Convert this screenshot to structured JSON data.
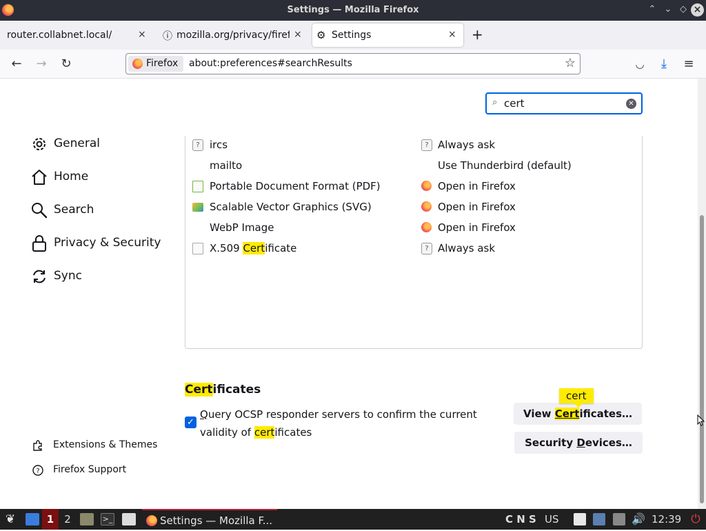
{
  "window": {
    "title": "Settings — Mozilla Firefox"
  },
  "tabs": [
    {
      "label": "router.collabnet.local/"
    },
    {
      "label": "mozilla.org/privacy/firefo"
    },
    {
      "label": "Settings"
    }
  ],
  "navbar": {
    "identity_label": "Firefox",
    "url": "about:preferences#searchResults"
  },
  "search": {
    "value": "cert"
  },
  "sidebar": {
    "categories": [
      {
        "label": "General",
        "icon": "gear-icon"
      },
      {
        "label": "Home",
        "icon": "home-icon"
      },
      {
        "label": "Search",
        "icon": "search-icon"
      },
      {
        "label": "Privacy & Security",
        "icon": "lock-icon"
      },
      {
        "label": "Sync",
        "icon": "sync-icon"
      }
    ],
    "footer": [
      {
        "label": "Extensions & Themes",
        "icon": "puzzle-icon"
      },
      {
        "label": "Firefox Support",
        "icon": "help-icon"
      }
    ]
  },
  "applications": {
    "rows": [
      {
        "type": "ircs",
        "action": "Always ask",
        "type_icon": "question-icon",
        "action_icon": "question-icon"
      },
      {
        "type": "mailto",
        "action": "Use Thunderbird (default)",
        "type_icon": "",
        "action_icon": ""
      },
      {
        "type": "Portable Document Format (PDF)",
        "action": "Open in Firefox",
        "type_icon": "pdf-file-icon",
        "action_icon": "firefox-icon"
      },
      {
        "type": "Scalable Vector Graphics (SVG)",
        "action": "Open in Firefox",
        "type_icon": "image-file-icon",
        "action_icon": "firefox-icon"
      },
      {
        "type": "WebP Image",
        "action": "Open in Firefox",
        "type_icon": "",
        "action_icon": "firefox-icon"
      },
      {
        "type_prefix": "X.509 ",
        "type_match": "Cert",
        "type_suffix": "ificate",
        "action": "Always ask",
        "type_icon": "file-icon",
        "action_icon": "question-icon"
      }
    ]
  },
  "certificates": {
    "heading_match": "Cert",
    "heading_rest": "ificates",
    "ocsp": {
      "checked": true,
      "text_q": "Q",
      "text_1": "uery OCSP responder servers to confirm the current validity of ",
      "text_match": "cert",
      "text_2": "ificates"
    },
    "view_button": {
      "pre": "View ",
      "match": "Cert",
      "rest": "ificates…"
    },
    "tooltip": "cert",
    "devices_button": {
      "pre": "Security ",
      "u": "D",
      "rest": "evices…"
    }
  },
  "taskbar": {
    "workspaces": [
      "1",
      "2"
    ],
    "task_label": "Settings — Mozilla F...",
    "indicators": "C N S",
    "layout": "US",
    "clock": "12:39"
  },
  "colors": {
    "highlight": "#ffeb00",
    "accent": "#0061e0",
    "titlebar": "#2b2e36",
    "taskbar": "#202020",
    "workspace_active": "#7a1010"
  }
}
